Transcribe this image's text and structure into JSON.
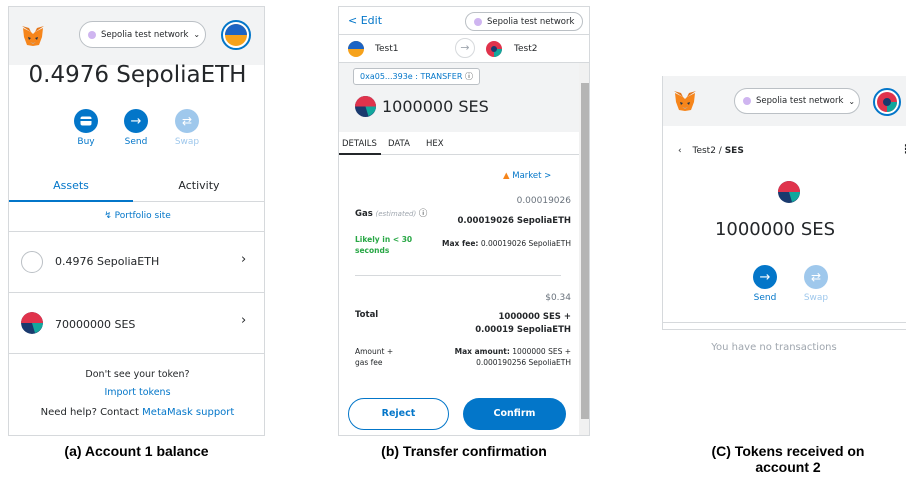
{
  "panel_a": {
    "network": "Sepolia test network",
    "balance": "0.4976 SepoliaETH",
    "actions": [
      {
        "label": "Buy",
        "enabled": true
      },
      {
        "label": "Send",
        "enabled": true
      },
      {
        "label": "Swap",
        "enabled": false
      }
    ],
    "tabs": {
      "assets": "Assets",
      "activity": "Activity"
    },
    "portfolio": "Portfolio site",
    "assets": [
      {
        "label": "0.4976 SepoliaETH"
      },
      {
        "label": "70000000 SES"
      }
    ],
    "dont_see": "Don't see your token?",
    "import_tokens": "Import tokens",
    "need_help": "Need help? Contact",
    "support": "MetaMask support"
  },
  "panel_b": {
    "back": "< Edit",
    "network": "Sepolia test network",
    "from_account": "Test1",
    "to_account": "Test2",
    "tx_badge": "0xa05...393e : TRANSFER",
    "amount": "1000000 SES",
    "tabs": [
      "DETAILS",
      "DATA",
      "HEX"
    ],
    "market": "Market >",
    "gas_usd": "0.00019026",
    "gas_label": "Gas",
    "gas_estimated": "(estimated)",
    "gas_value": "0.00019026 SepoliaETH",
    "likely": "Likely in < 30 seconds",
    "max_fee_label": "Max fee:",
    "max_fee_value": "0.00019026 SepoliaETH",
    "total_usd": "$0.34",
    "total_label": "Total",
    "total_value_1": "1000000 SES +",
    "total_value_2": "0.00019 SepoliaETH",
    "amount_gas_1": "Amount +",
    "amount_gas_2": "gas fee",
    "max_amount_label": "Max amount:",
    "max_amount_value_1": "1000000 SES +",
    "max_amount_value_2": "0.000190256 SepoliaETH",
    "reject": "Reject",
    "confirm": "Confirm"
  },
  "panel_c": {
    "network": "Sepolia test network",
    "breadcrumb_account": "Test2",
    "breadcrumb_sep": " / ",
    "breadcrumb_token": "SES",
    "balance": "1000000 SES",
    "actions": [
      {
        "label": "Send",
        "enabled": true
      },
      {
        "label": "Swap",
        "enabled": false
      }
    ],
    "empty": "You have no transactions"
  },
  "captions": {
    "a": "(a) Account 1 balance",
    "b": "(b) Transfer confirmation",
    "c": "(C) Tokens received on account 2"
  },
  "colors": {
    "primary": "#0376c9",
    "primary_faded": "#9fc8ec",
    "success": "#28a745",
    "network_dot": "#cfb5f0"
  }
}
